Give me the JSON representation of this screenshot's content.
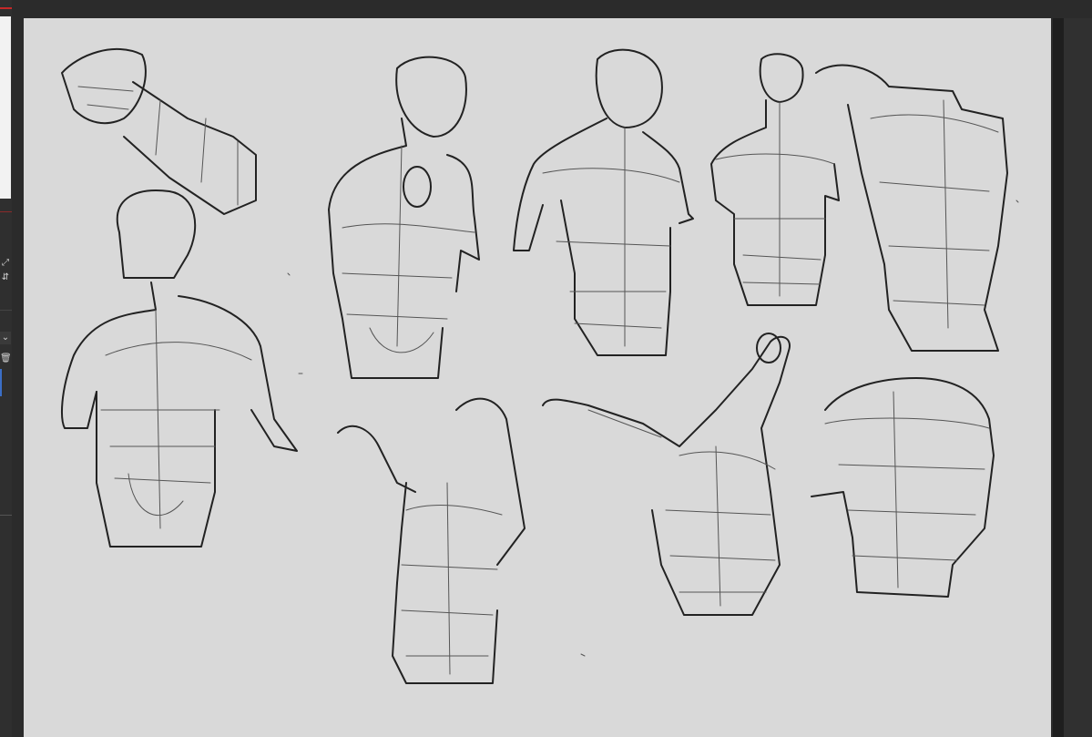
{
  "app": {
    "panel_icons": [
      "resize-icon",
      "flip-vertical-icon",
      "chevron-down-icon",
      "trash-icon"
    ],
    "colors": {
      "background": "#2b2b2b",
      "canvas": "#d9d9d9",
      "accent": "#c62828",
      "selection": "#3b6ec6",
      "ink": "#222222"
    }
  },
  "canvas": {
    "drawing_subjects": [
      "torso-sketch",
      "torso-sketch",
      "torso-sketch",
      "torso-sketch",
      "torso-sketch",
      "torso-sketch",
      "torso-sketch",
      "torso-sketch",
      "torso-sketch",
      "torso-sketch"
    ]
  }
}
